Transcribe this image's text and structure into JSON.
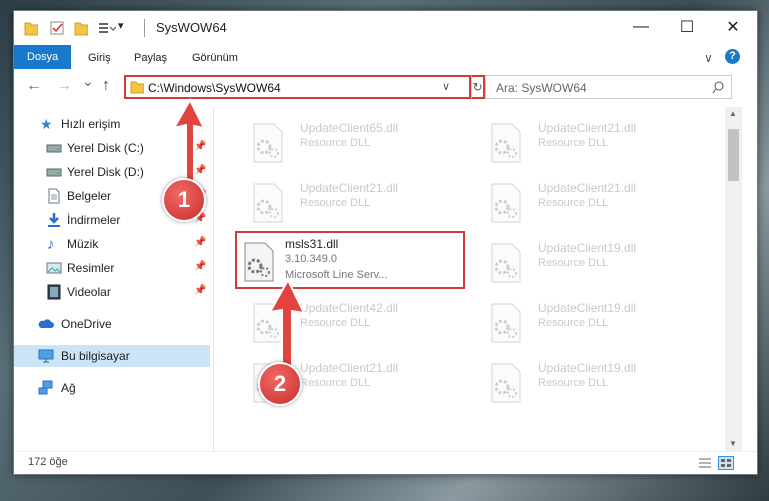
{
  "window": {
    "title": "SysWOW64"
  },
  "window_controls": {
    "minimize": "—",
    "maximize": "☐",
    "close": "✕"
  },
  "ribbon": {
    "tabs": [
      "Dosya",
      "Giriş",
      "Paylaş",
      "Görünüm"
    ],
    "expand": "∨",
    "help": "?"
  },
  "nav": {
    "back": "←",
    "forward": "→",
    "recent": "⌄",
    "up": "↑"
  },
  "address": {
    "path": "C:\\Windows\\SysWOW64",
    "dropdown": "∨",
    "refresh": "↻"
  },
  "search": {
    "placeholder": "Ara: SysWOW64"
  },
  "sidebar": {
    "items": [
      {
        "label": "Hızlı erişim",
        "icon": "star-icon"
      },
      {
        "label": "Yerel Disk (C:)",
        "icon": "drive-icon",
        "pin": "📌"
      },
      {
        "label": "Yerel Disk (D:)",
        "icon": "drive-icon",
        "pin": "📌"
      },
      {
        "label": "Belgeler",
        "icon": "document-icon",
        "pin": "📌"
      },
      {
        "label": "İndirmeler",
        "icon": "download-icon",
        "pin": "📌"
      },
      {
        "label": "Müzik",
        "icon": "music-icon",
        "pin": "📌"
      },
      {
        "label": "Resimler",
        "icon": "pictures-icon",
        "pin": "📌"
      },
      {
        "label": "Videolar",
        "icon": "video-icon",
        "pin": "📌"
      },
      {
        "label": "OneDrive",
        "icon": "cloud-icon"
      },
      {
        "label": "Bu bilgisayar",
        "icon": "computer-icon"
      },
      {
        "label": "Ağ",
        "icon": "network-icon"
      }
    ]
  },
  "files": [
    {
      "name": "UpdateClient65.dll",
      "desc": "Resource DLL"
    },
    {
      "name": "UpdateClient21.dll",
      "desc": "Resource DLL"
    },
    {
      "name": "UpdateClient21.dll",
      "desc": "Resource DLL"
    },
    {
      "name": "UpdateClient21.dll",
      "desc": "Resource DLL"
    },
    {
      "name": "msls31.dll",
      "version": "3.10.349.0",
      "desc": "Microsoft Line Serv..."
    },
    {
      "name": "UpdateClient19.dll",
      "desc": "Resource DLL"
    },
    {
      "name": "UpdateClient42.dll",
      "desc": "Resource DLL"
    },
    {
      "name": "UpdateClient19.dll",
      "desc": "Resource DLL"
    },
    {
      "name": "UpdateClient21.dll",
      "desc": "Resource DLL"
    },
    {
      "name": "UpdateClient19.dll",
      "desc": "Resource DLL"
    }
  ],
  "status": {
    "count": "172 öğe"
  },
  "annotations": {
    "step1": "1",
    "step2": "2"
  },
  "colors": {
    "accent": "#1979ca",
    "highlight": "#d23b38",
    "selected": "#cce4f7"
  }
}
